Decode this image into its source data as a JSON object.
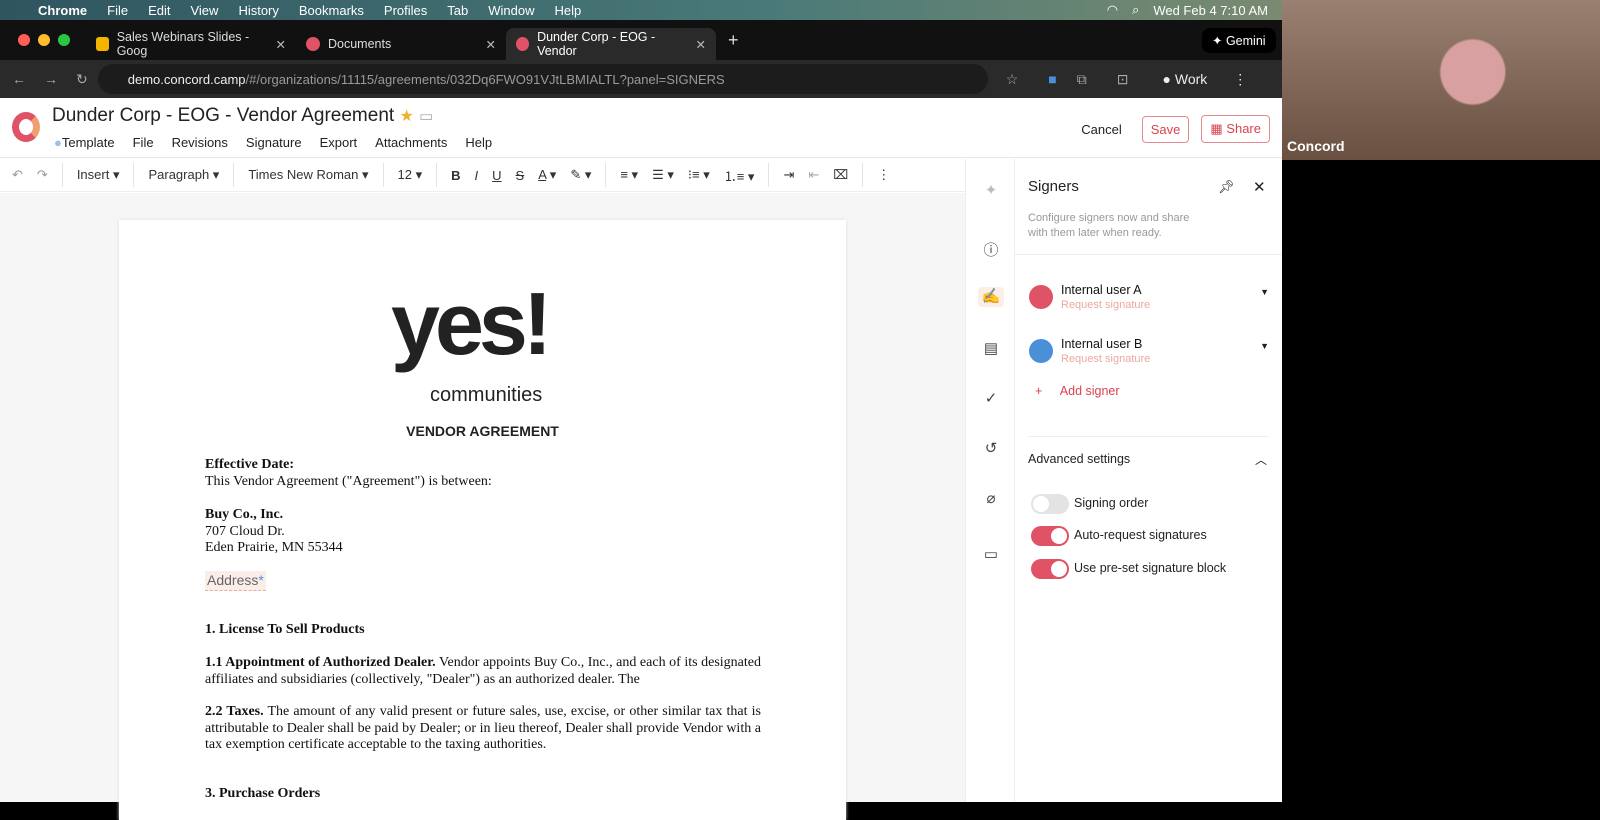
{
  "mac": {
    "app": "Chrome",
    "menus": [
      "File",
      "Edit",
      "View",
      "History",
      "Bookmarks",
      "Profiles",
      "Tab",
      "Window",
      "Help"
    ],
    "clock": "Wed Feb 4  7:10 AM"
  },
  "tabs": [
    {
      "title": "Sales Webinars Slides - Goog",
      "color": "#f4b400"
    },
    {
      "title": "Documents",
      "color": "#e05265"
    },
    {
      "title": "Dunder Corp - EOG - Vendor",
      "color": "#e05265"
    }
  ],
  "gemini": "Gemini",
  "address": {
    "host": "demo.concord.camp",
    "path": "/#/organizations/11115/agreements/032Dq6FWO91VJtLBMIALTL?panel=SIGNERS",
    "profile": "Work"
  },
  "header": {
    "title": "Dunder Corp - EOG - Vendor Agreement",
    "status": "Template",
    "menus": [
      "File",
      "Revisions",
      "Signature",
      "Export",
      "Attachments",
      "Help"
    ],
    "cancel": "Cancel",
    "save": "Save",
    "share": "Share"
  },
  "toolbar": {
    "insert": "Insert",
    "style": "Paragraph",
    "font": "Times New Roman",
    "size": "12"
  },
  "doc": {
    "logo_text": "yes!",
    "logo_sub": "communities",
    "heading": "VENDOR AGREEMENT",
    "effective": "Effective Date:",
    "intro": "This Vendor Agreement (\"Agreement\") is between:",
    "company": "Buy Co., Inc.",
    "street": "707 Cloud Dr.",
    "city": "Eden Prairie, MN 55344",
    "field": "Address",
    "section1": "1.   License To Sell Products",
    "p11_bold": "1.1 Appointment of Authorized Dealer.",
    "p11": " Vendor appoints Buy Co., Inc., and each of its designated affiliates and subsidiaries (collectively, \"Dealer\") as an authorized dealer. The",
    "p22_bold": "2.2 Taxes.",
    "p22": " The amount of any valid present or future sales, use, excise, or other similar tax that is attributable to Dealer shall be paid by Dealer; or in lieu thereof, Dealer shall provide Vendor with a tax exemption certificate acceptable to the taxing authorities.",
    "section3": "3.   Purchase Orders"
  },
  "panel": {
    "title": "Signers",
    "desc": "Configure signers now and share with them later when ready.",
    "signers": [
      {
        "name": "Internal user A",
        "action": "Request signature",
        "color": "#e05265"
      },
      {
        "name": "Internal user B",
        "action": "Request signature",
        "color": "#4a90d9"
      }
    ],
    "add": "Add signer",
    "advanced": "Advanced settings",
    "toggles": [
      {
        "label": "Signing order",
        "on": false
      },
      {
        "label": "Auto-request signatures",
        "on": true
      },
      {
        "label": "Use pre-set signature block",
        "on": true
      }
    ]
  },
  "webcam": {
    "label": "Concord"
  },
  "colors": {
    "accent": "#e05265"
  }
}
